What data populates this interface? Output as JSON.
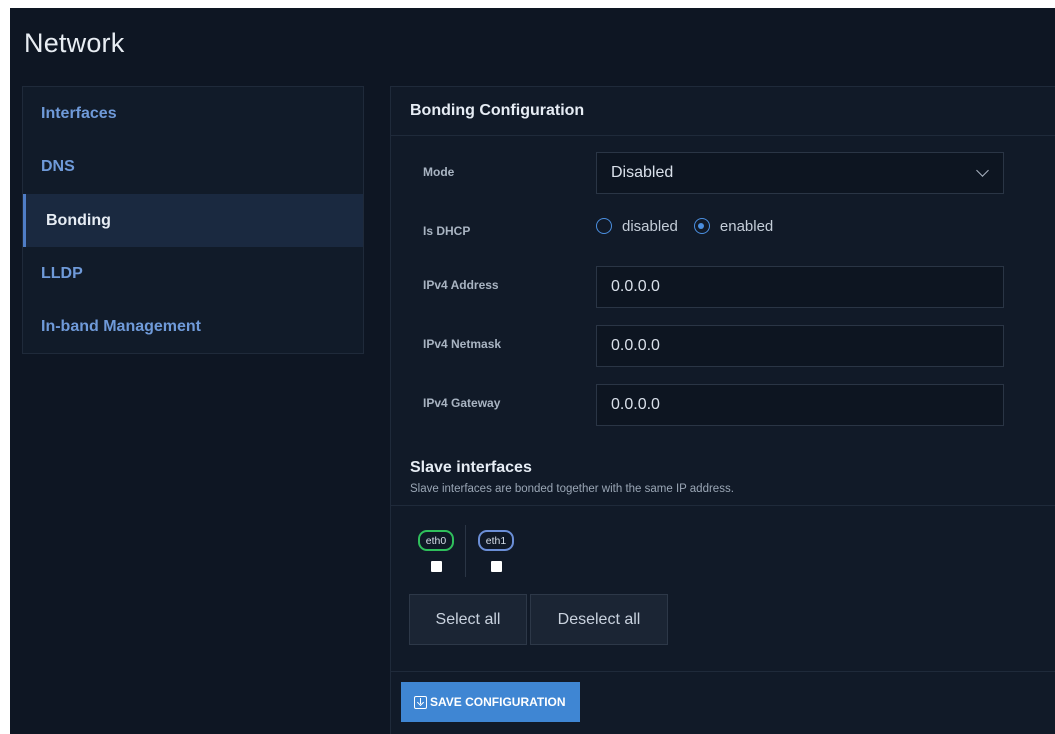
{
  "page": {
    "title": "Network"
  },
  "sidebar": {
    "items": [
      {
        "label": "Interfaces",
        "active": false
      },
      {
        "label": "DNS",
        "active": false
      },
      {
        "label": "Bonding",
        "active": true
      },
      {
        "label": "LLDP",
        "active": false
      },
      {
        "label": "In-band Management",
        "active": false
      }
    ]
  },
  "bonding": {
    "header": "Bonding Configuration",
    "mode": {
      "label": "Mode",
      "value": "Disabled"
    },
    "dhcp": {
      "label": "Is DHCP",
      "options": [
        "disabled",
        "enabled"
      ],
      "selected": "enabled"
    },
    "ipv4_address": {
      "label": "IPv4 Address",
      "value": "0.0.0.0"
    },
    "ipv4_netmask": {
      "label": "IPv4 Netmask",
      "value": "0.0.0.0"
    },
    "ipv4_gateway": {
      "label": "IPv4 Gateway",
      "value": "0.0.0.0"
    }
  },
  "slaves": {
    "title": "Slave interfaces",
    "description": "Slave interfaces are bonded together with the same IP address.",
    "interfaces": [
      {
        "name": "eth0",
        "color": "#2fbf5c",
        "checked": false
      },
      {
        "name": "eth1",
        "color": "#6b8ed6",
        "checked": false
      }
    ],
    "select_all": "Select all",
    "deselect_all": "Deselect all"
  },
  "footer": {
    "save_label": "SAVE CONFIGURATION"
  },
  "colors": {
    "accent": "#3f86d3",
    "background": "#0e1623"
  }
}
